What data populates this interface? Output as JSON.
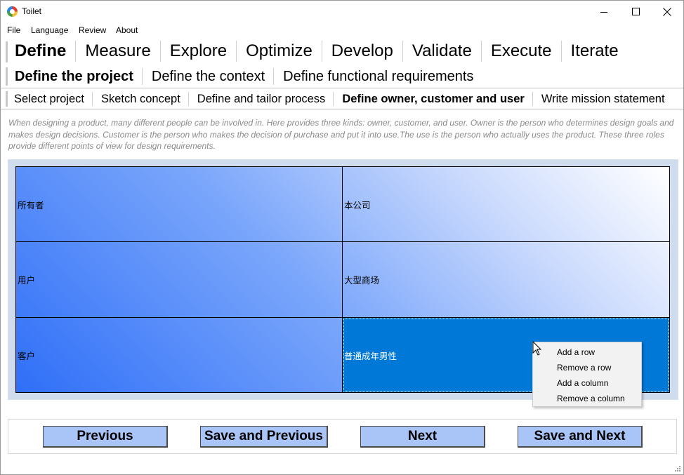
{
  "window": {
    "title": "Toilet"
  },
  "menubar": [
    "File",
    "Language",
    "Review",
    "About"
  ],
  "nav_level1": {
    "items": [
      "Define",
      "Measure",
      "Explore",
      "Optimize",
      "Develop",
      "Validate",
      "Execute",
      "Iterate"
    ],
    "active": "Define"
  },
  "nav_level2": {
    "items": [
      "Define the project",
      "Define the context",
      "Define functional requirements"
    ],
    "active": "Define the project"
  },
  "nav_level3": {
    "items": [
      "Select project",
      "Sketch concept",
      "Define and tailor process",
      "Define owner, customer and user",
      "Write mission statement"
    ],
    "active": "Define owner, customer and user"
  },
  "description": "When designing a product, many different people can be involved in. Here provides three kinds: owner, customer, and user. Owner is the person who determines design goals and makes design decisions. Customer is the person who makes the decision of purchase and put it into use.The use is the person who actually uses the product. These three roles provide different points of view for design requirements.",
  "grid": {
    "rows": [
      [
        "所有者",
        "本公司"
      ],
      [
        "用户",
        "大型商场"
      ],
      [
        "客户",
        "普通成年男性"
      ]
    ],
    "selected_cell": "普通成年男性"
  },
  "context_menu": [
    "Add a row",
    "Remove a row",
    "Add a column",
    "Remove a column"
  ],
  "buttons": {
    "previous": "Previous",
    "save_previous": "Save and Previous",
    "next": "Next",
    "save_next": "Save and Next"
  },
  "colors": {
    "selected_cell": "#0078d7",
    "button_bg": "#a9c5f8",
    "description_text": "#8a8a8a",
    "grid_gradient_start": "#2f6ff8"
  }
}
